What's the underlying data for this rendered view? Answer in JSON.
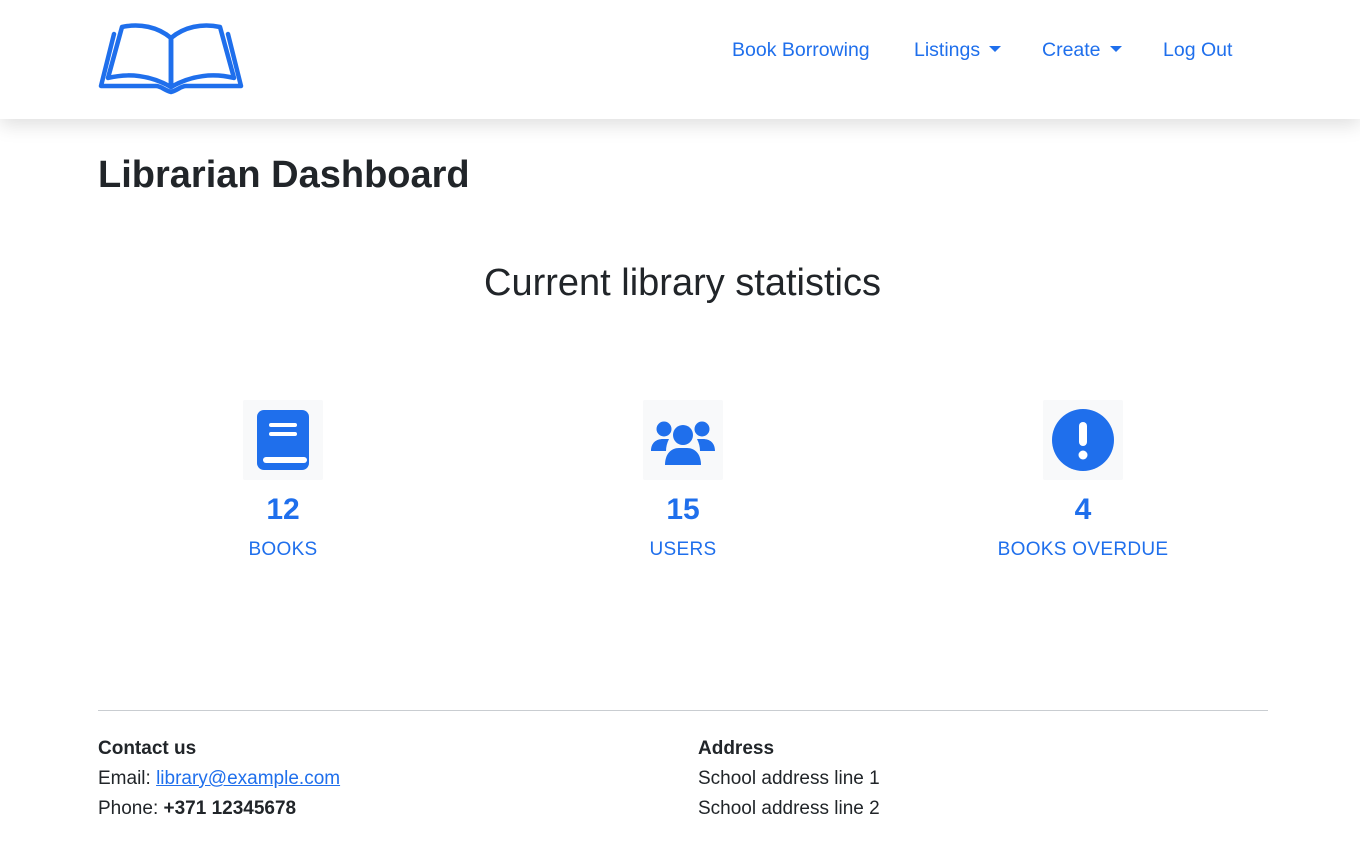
{
  "nav": {
    "logo": "open-book-icon",
    "links": [
      {
        "label": "Book Borrowing"
      },
      {
        "label": "Listings"
      },
      {
        "label": "Create"
      },
      {
        "label": "Log Out"
      }
    ]
  },
  "page": {
    "title": "Librarian Dashboard",
    "subtitle": "Current library statistics"
  },
  "stats": [
    {
      "icon": "book-icon",
      "value": "12",
      "label": "BOOKS"
    },
    {
      "icon": "users-icon",
      "value": "15",
      "label": "USERS"
    },
    {
      "icon": "exclamation-circle-icon",
      "value": "4",
      "label": "BOOKS OVERDUE"
    }
  ],
  "footer": {
    "contact": {
      "heading": "Contact us",
      "email_label": "Email:",
      "email": "library@example.com",
      "phone_label": "Phone:",
      "phone": "+371 12345678"
    },
    "address": {
      "heading": "Address",
      "line1": "School address line 1",
      "line2": "School address line 2"
    }
  },
  "colors": {
    "accent": "#1f6fec",
    "text": "#212529",
    "divider": "#c9cdd1"
  }
}
